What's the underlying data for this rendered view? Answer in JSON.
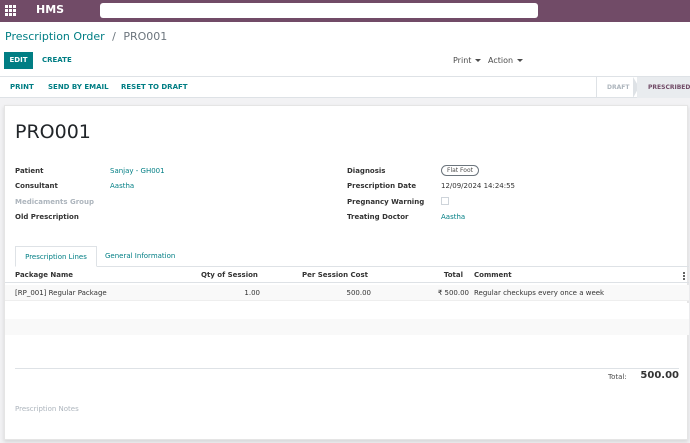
{
  "app": {
    "brand": "HMS"
  },
  "breadcrumb": {
    "parent": "Prescription Order",
    "separator": "/",
    "current": "PRO001"
  },
  "buttons": {
    "edit": "EDIT",
    "create": "CREATE",
    "print": "Print",
    "action": "Action"
  },
  "statusbar": {
    "actions": [
      "PRINT",
      "SEND BY EMAIL",
      "RESET TO DRAFT"
    ],
    "stages": {
      "draft": "DRAFT",
      "prescribed": "PRESCRIBED",
      "current": "PRESCRIBED"
    }
  },
  "record": {
    "name": "PRO001",
    "left": {
      "patient_label": "Patient",
      "patient": "Sanjay - GH001",
      "consultant_label": "Consultant",
      "consultant": "Aastha",
      "medicaments_group_label": "Medicaments Group",
      "old_prescription_label": "Old Prescription"
    },
    "right": {
      "diagnosis_label": "Diagnosis",
      "diagnosis": "Flat Foot",
      "prescription_date_label": "Prescription Date",
      "prescription_date": "12/09/2024 14:24:55",
      "pregnancy_warning_label": "Pregnancy Warning",
      "treating_doctor_label": "Treating Doctor",
      "treating_doctor": "Aastha"
    }
  },
  "tabs": [
    "Prescription Lines",
    "General Information"
  ],
  "lines": {
    "columns": [
      "Package Name",
      "Qty of Session",
      "Per Session Cost",
      "Total",
      "Comment"
    ],
    "rows": [
      {
        "package": "[RP_001] Regular Package",
        "qty": "1.00",
        "cost": "500.00",
        "total": "₹ 500.00",
        "comment": "Regular checkups every once a week"
      }
    ],
    "total_label": "Total:",
    "total_value": "500.00"
  },
  "notes": {
    "label": "Prescription Notes"
  },
  "colors": {
    "brand": "#714b67",
    "primary": "#017e84"
  }
}
